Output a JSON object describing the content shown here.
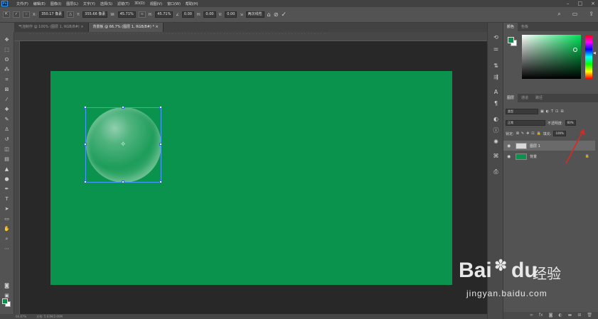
{
  "app": {
    "logo": "Ps"
  },
  "menu": {
    "items": [
      "文件(F)",
      "编辑(E)",
      "图像(I)",
      "图层(L)",
      "文字(Y)",
      "选择(S)",
      "滤镜(T)",
      "3D(D)",
      "视图(V)",
      "窗口(W)",
      "帮助(H)"
    ]
  },
  "options": {
    "x_label": "X:",
    "x_value": "350.17 像素",
    "y_label": "Y:",
    "y_value": "355.66 像素",
    "w_label": "W:",
    "w_value": "45.71%",
    "h_label": "H:",
    "h_value": "45.71%",
    "angle_value": "0.00",
    "h_skew_label": "H:",
    "h_skew_value": "0.00",
    "v_skew_label": "V:",
    "v_skew_value": "0.00",
    "interp_value": "两次线性"
  },
  "tabs": [
    {
      "label": "气泡制作 @ 100% (图层 1, RGB/8#) ×"
    },
    {
      "label": "背景板 @ 66.7% (图层 1, RGB/8#) * ×"
    }
  ],
  "status": {
    "zoom": "66.67%",
    "doc": "文档: 5.63M/2.00M"
  },
  "color_panel": {
    "tabs": [
      "颜色",
      "色板"
    ]
  },
  "layers_panel": {
    "tabs": [
      "图层",
      "通道",
      "路径"
    ],
    "filter_label": "类型",
    "blend_mode": "正常",
    "opacity_label": "不透明度:",
    "opacity_value": "60%",
    "lock_label": "锁定:",
    "fill_label": "填充:",
    "fill_value": "100%",
    "layers": [
      {
        "name": "图层 1",
        "selected": true
      },
      {
        "name": "背景",
        "selected": false
      }
    ]
  },
  "watermark": {
    "brand": "Bai",
    "du": "du",
    "jingyan": "经验",
    "url": "jingyan.baidu.com"
  },
  "colors": {
    "canvas_green": "#0a934c",
    "selection_blue": "#4a9bff",
    "arrow_red": "#e0261f"
  }
}
